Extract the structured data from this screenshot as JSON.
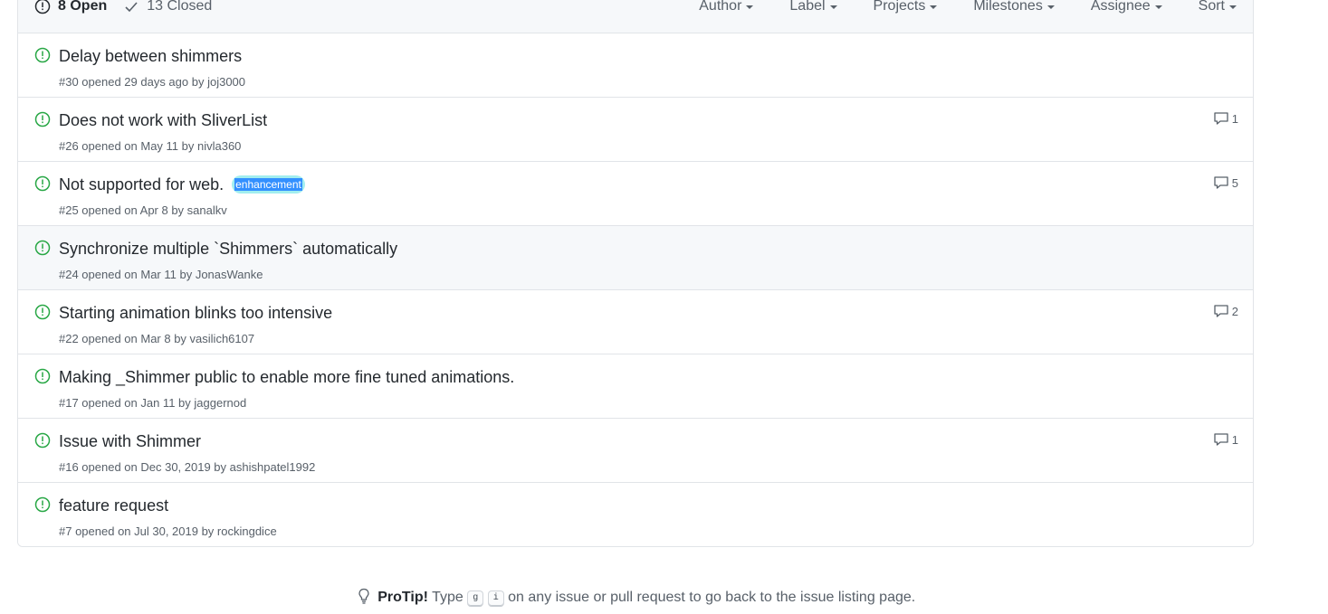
{
  "header": {
    "open_label": "8 Open",
    "closed_label": "13 Closed",
    "filters": [
      "Author",
      "Label",
      "Projects",
      "Milestones",
      "Assignee",
      "Sort"
    ]
  },
  "issues": [
    {
      "title": "Delay between shimmers",
      "meta": "#30 opened 29 days ago by joj3000",
      "comments": ""
    },
    {
      "title": "Does not work with SliverList",
      "meta": "#26 opened on May 11 by nivla360",
      "comments": "1"
    },
    {
      "title": "Not supported for web.",
      "label": "enhancement",
      "meta": "#25 opened on Apr 8 by sanalkv",
      "comments": "5"
    },
    {
      "title": "Synchronize multiple `Shimmers` automatically",
      "meta": "#24 opened on Mar 11 by JonasWanke",
      "comments": ""
    },
    {
      "title": "Starting animation blinks too intensive",
      "meta": "#22 opened on Mar 8 by vasilich6107",
      "comments": "2"
    },
    {
      "title": "Making _Shimmer public to enable more fine tuned animations.",
      "meta": "#17 opened on Jan 11 by jaggernod",
      "comments": ""
    },
    {
      "title": "Issue with Shimmer",
      "meta": "#16 opened on Dec 30, 2019 by ashishpatel1992",
      "comments": "1"
    },
    {
      "title": "feature request",
      "meta": "#7 opened on Jul 30, 2019 by rockingdice",
      "comments": ""
    }
  ],
  "protip": {
    "bold": "ProTip!",
    "before": "Type",
    "key1": "g",
    "key2": "i",
    "after": "on any issue or pull request to go back to the issue listing page."
  },
  "colors": {
    "open_icon": "#28a745",
    "label_bg": "#a2eeef",
    "selection": "#3390ff"
  }
}
